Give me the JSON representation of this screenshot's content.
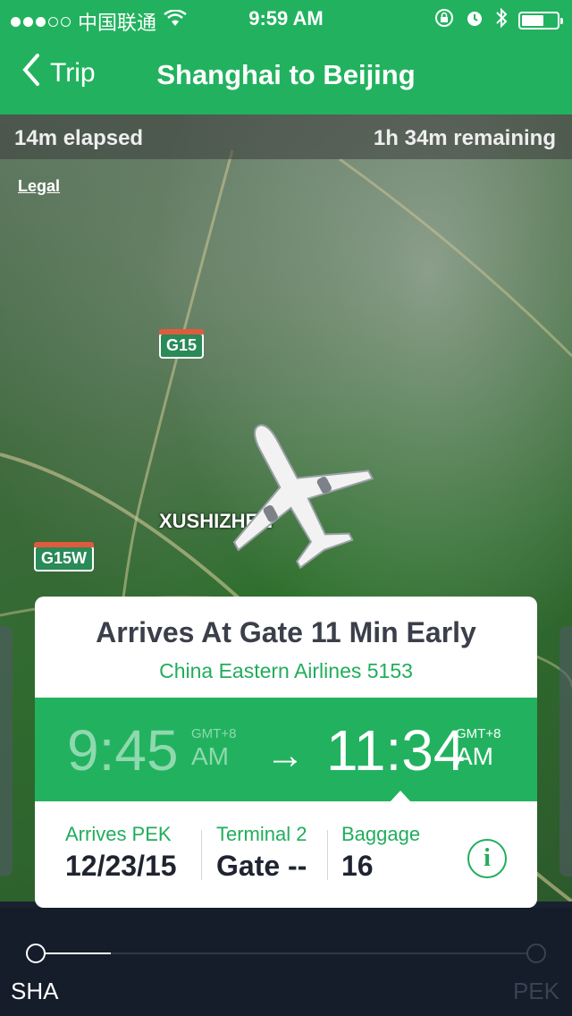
{
  "status": {
    "carrier": "中国联通",
    "time": "9:59 AM",
    "signal": "3 of 5 dots filled",
    "battery_level": 0.62
  },
  "nav": {
    "back_label": "Trip",
    "title": "Shanghai to Beijing"
  },
  "map": {
    "elapsed": "14m elapsed",
    "remaining": "1h 34m remaining",
    "legal": "Legal",
    "road1": "G15",
    "road2": "G15W",
    "place": "XUSHIZHEN"
  },
  "card": {
    "headline": "Arrives At Gate 11 Min Early",
    "flight": "China Eastern Airlines 5153",
    "departure": {
      "time": "9:45",
      "tz": "GMT+8",
      "ampm": "AM"
    },
    "arrival": {
      "time": "11:34",
      "tz": "GMT+8",
      "ampm": "AM"
    },
    "arrow": "→",
    "details": [
      {
        "label": "Arrives PEK",
        "value": "12/23/15"
      },
      {
        "label": "Terminal 2",
        "value": "Gate --"
      },
      {
        "label": "Baggage",
        "value": "16"
      }
    ],
    "info_glyph": "i"
  },
  "progress": {
    "origin": "SHA",
    "destination": "PEK",
    "fraction": 0.15
  },
  "colors": {
    "accent": "#22b25f",
    "accent_text": "#21ad5c",
    "bottom_bg": "#151c2a"
  }
}
